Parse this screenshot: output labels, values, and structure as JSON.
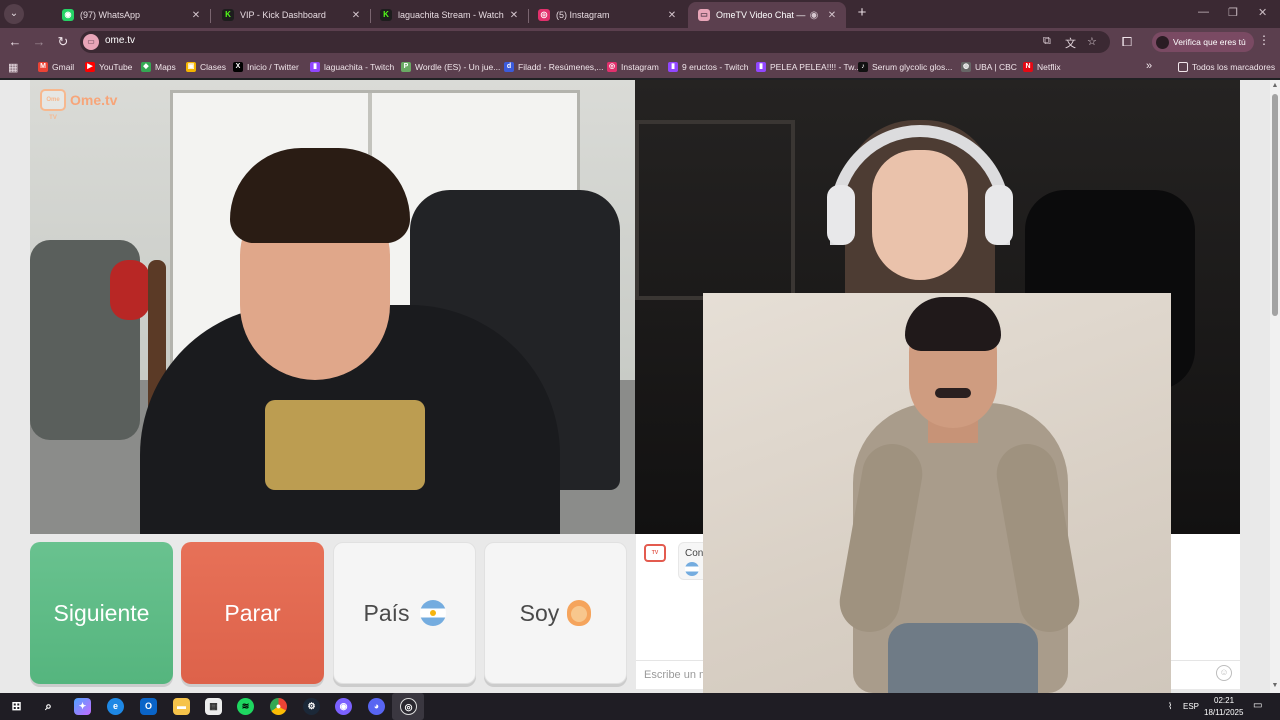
{
  "browser": {
    "tabs": [
      {
        "title": "(97) WhatsApp",
        "icon": "whatsapp-icon",
        "color": "#25d366"
      },
      {
        "title": "VIP - Kick Dashboard",
        "icon": "kick-icon",
        "color": "#53fc18"
      },
      {
        "title": "laguachita Stream - Watch Live",
        "icon": "kick-icon",
        "color": "#53fc18"
      },
      {
        "title": "(5) Instagram",
        "icon": "instagram-icon",
        "color": "#e1306c"
      },
      {
        "title": "OmeTV Video Chat — Ome",
        "icon": "ometv-icon",
        "color": "#e8a5b8"
      }
    ],
    "url": "ome.tv",
    "profile_label": "Verifica que eres tú",
    "bookmarks": [
      {
        "label": "Gmail",
        "icon": "gmail-icon",
        "color": "#ea4335"
      },
      {
        "label": "YouTube",
        "icon": "youtube-icon",
        "color": "#ff0000"
      },
      {
        "label": "Maps",
        "icon": "maps-icon",
        "color": "#34a853"
      },
      {
        "label": "Clases",
        "icon": "classroom-icon",
        "color": "#f4b400"
      },
      {
        "label": "Inicio / Twitter",
        "icon": "x-icon",
        "color": "#000000"
      },
      {
        "label": "laguachita - Twitch",
        "icon": "twitch-icon",
        "color": "#9146ff"
      },
      {
        "label": "Wordle (ES) - Un jue...",
        "icon": "wordle-icon",
        "color": "#6aaa64"
      },
      {
        "label": "Filadd - Resúmenes,...",
        "icon": "filadd-icon",
        "color": "#3b5bdb"
      },
      {
        "label": "Instagram",
        "icon": "instagram-icon",
        "color": "#e1306c"
      },
      {
        "label": "9 eructos - Twitch",
        "icon": "twitch-icon",
        "color": "#9146ff"
      },
      {
        "label": "PELEA PELEA!!!! - Tw...",
        "icon": "twitch-icon",
        "color": "#9146ff"
      },
      {
        "label": "Serum glycolic glos...",
        "icon": "tiktok-icon",
        "color": "#111111"
      },
      {
        "label": "UBA | CBC",
        "icon": "globe-icon",
        "color": "#666666"
      },
      {
        "label": "Netflix",
        "icon": "netflix-icon",
        "color": "#e50914"
      }
    ],
    "all_bookmarks_label": "Todos los marcadores"
  },
  "app": {
    "logo_text": "Ome.tv",
    "logo_badge": "Ome TV",
    "buttons": {
      "next": "Siguiente",
      "stop": "Parar",
      "country": "País",
      "gender": "Soy"
    },
    "chat": {
      "message_prefix": "Con",
      "input_placeholder": "Escribe un m"
    }
  },
  "taskbar": {
    "language": "ESP",
    "time": "02:21",
    "date": "18/11/2025",
    "apps": [
      "windows-start-icon",
      "search-icon",
      "copilot-icon",
      "edge-icon",
      "outlook-icon",
      "file-explorer-icon",
      "store-icon",
      "spotify-icon",
      "chrome-icon",
      "steam-icon",
      "obs-icon",
      "discord-icon",
      "ometv-app-icon"
    ]
  },
  "colors": {
    "next": "#5dbb85",
    "stop": "#e26a51",
    "brand": "#f7a579"
  }
}
